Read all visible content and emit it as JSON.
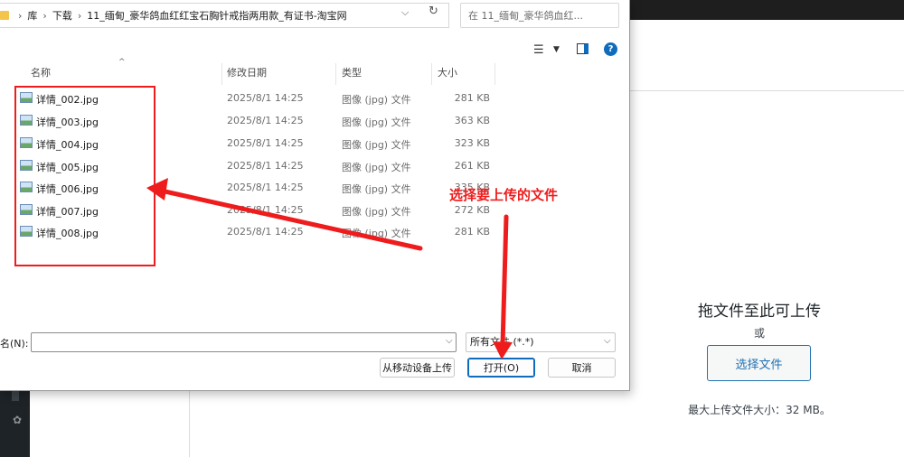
{
  "background_page": {
    "upload_title": "拖文件至此可上传",
    "upload_or": "或",
    "select_button": "选择文件",
    "max_size": "最大上传文件大小：32 MB。"
  },
  "dialog": {
    "breadcrumb": [
      "库",
      "下载",
      "11_缅甸_豪华鸽血红红宝石胸针戒指两用款_有证书-淘宝网"
    ],
    "search_placeholder": "在 11_缅甸_豪华鸽血红...",
    "columns": {
      "name": "名称",
      "date": "修改日期",
      "type": "类型",
      "size": "大小"
    },
    "files": [
      {
        "name": "详情_002.jpg",
        "date": "2025/8/1 14:25",
        "type": "图像 (jpg) 文件",
        "size": "281 KB"
      },
      {
        "name": "详情_003.jpg",
        "date": "2025/8/1 14:25",
        "type": "图像 (jpg) 文件",
        "size": "363 KB"
      },
      {
        "name": "详情_004.jpg",
        "date": "2025/8/1 14:25",
        "type": "图像 (jpg) 文件",
        "size": "323 KB"
      },
      {
        "name": "详情_005.jpg",
        "date": "2025/8/1 14:25",
        "type": "图像 (jpg) 文件",
        "size": "261 KB"
      },
      {
        "name": "详情_006.jpg",
        "date": "2025/8/1 14:25",
        "type": "图像 (jpg) 文件",
        "size": "335 KB"
      },
      {
        "name": "详情_007.jpg",
        "date": "2025/8/1 14:25",
        "type": "图像 (jpg) 文件",
        "size": "272 KB"
      },
      {
        "name": "详情_008.jpg",
        "date": "2025/8/1 14:25",
        "type": "图像 (jpg) 文件",
        "size": "281 KB"
      }
    ],
    "filename_label": "名(N):",
    "filename_value": "",
    "filetype": "所有文件 (*.*)",
    "mobile_button": "从移动设备上传",
    "open_button": "打开(O)",
    "cancel_button": "取消"
  },
  "annotation": {
    "text": "选择要上传的文件",
    "color": "#ee1c1c"
  }
}
